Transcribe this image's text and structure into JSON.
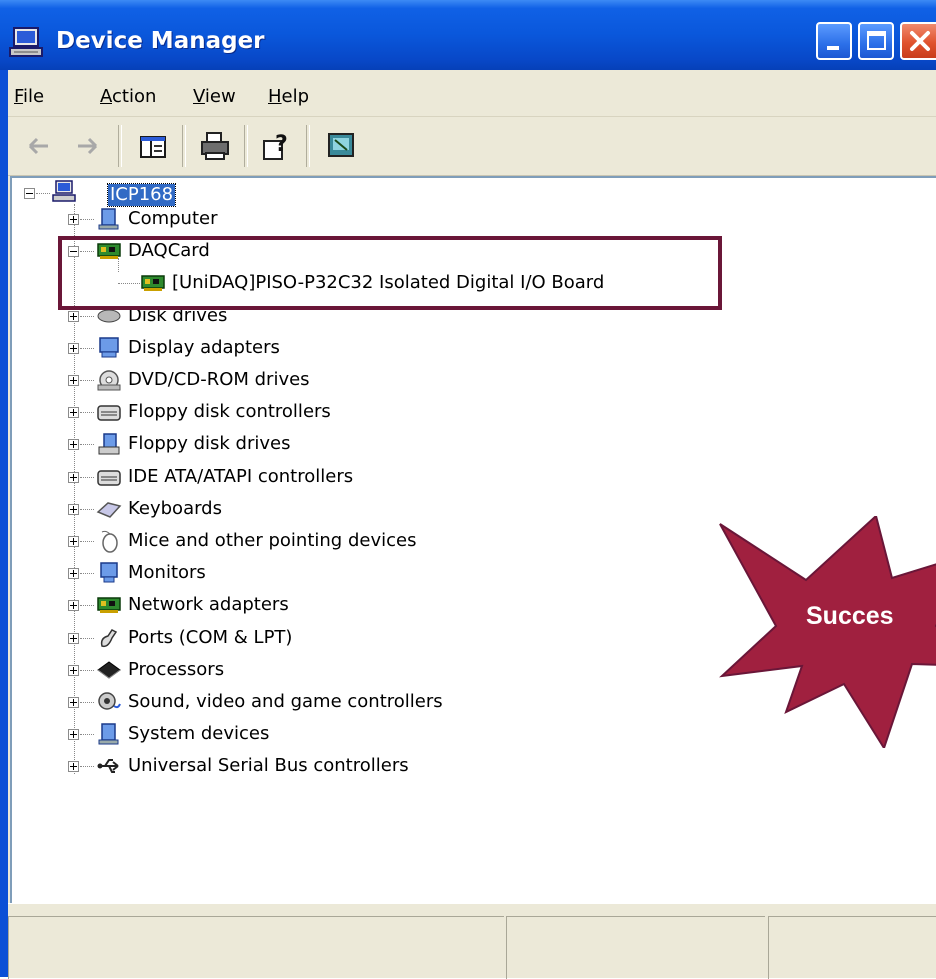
{
  "window": {
    "title": "Device Manager",
    "buttons": {
      "minimize": "minimize",
      "maximize": "maximize",
      "close": "close"
    }
  },
  "menu": [
    {
      "label": "File",
      "mnemonic": "F",
      "rest": "ile"
    },
    {
      "label": "Action",
      "mnemonic": "A",
      "rest": "ction"
    },
    {
      "label": "View",
      "mnemonic": "V",
      "rest": "iew"
    },
    {
      "label": "Help",
      "mnemonic": "H",
      "rest": "elp"
    }
  ],
  "toolbar": {
    "icons": [
      "back-arrow-icon",
      "forward-arrow-icon",
      "show-hide-tree-icon",
      "print-icon",
      "help-properties-icon",
      "scan-hardware-icon"
    ]
  },
  "tree": {
    "root": "ICP168",
    "items": [
      {
        "label": "Computer",
        "icon": "computer-icon",
        "expanded": false
      },
      {
        "label": "DAQCard",
        "icon": "card-icon",
        "expanded": true,
        "children": [
          {
            "label": "[UniDAQ]PISO-P32C32 Isolated Digital I/O Board",
            "icon": "card-icon"
          }
        ]
      },
      {
        "label": "Disk drives",
        "icon": "disk-icon",
        "expanded": false
      },
      {
        "label": "Display adapters",
        "icon": "display-icon",
        "expanded": false
      },
      {
        "label": "DVD/CD-ROM drives",
        "icon": "cdrom-icon",
        "expanded": false
      },
      {
        "label": "Floppy disk controllers",
        "icon": "controller-icon",
        "expanded": false
      },
      {
        "label": "Floppy disk drives",
        "icon": "floppy-icon",
        "expanded": false
      },
      {
        "label": "IDE ATA/ATAPI controllers",
        "icon": "controller-icon",
        "expanded": false
      },
      {
        "label": "Keyboards",
        "icon": "keyboard-icon",
        "expanded": false
      },
      {
        "label": "Mice and other pointing devices",
        "icon": "mouse-icon",
        "expanded": false
      },
      {
        "label": "Monitors",
        "icon": "monitor-icon",
        "expanded": false
      },
      {
        "label": "Network adapters",
        "icon": "card-icon",
        "expanded": false
      },
      {
        "label": "Ports (COM & LPT)",
        "icon": "port-icon",
        "expanded": false
      },
      {
        "label": "Processors",
        "icon": "processor-icon",
        "expanded": false
      },
      {
        "label": "Sound, video and game controllers",
        "icon": "sound-icon",
        "expanded": false
      },
      {
        "label": "System devices",
        "icon": "system-icon",
        "expanded": false
      },
      {
        "label": "Universal Serial Bus controllers",
        "icon": "usb-icon",
        "expanded": false
      }
    ]
  },
  "annotation": {
    "burst_text": "Succes"
  },
  "colors": {
    "title_blue": "#0a57db",
    "highlight_border": "#6a1638",
    "burst_fill": "#a0203f",
    "selection": "#316ac5"
  }
}
